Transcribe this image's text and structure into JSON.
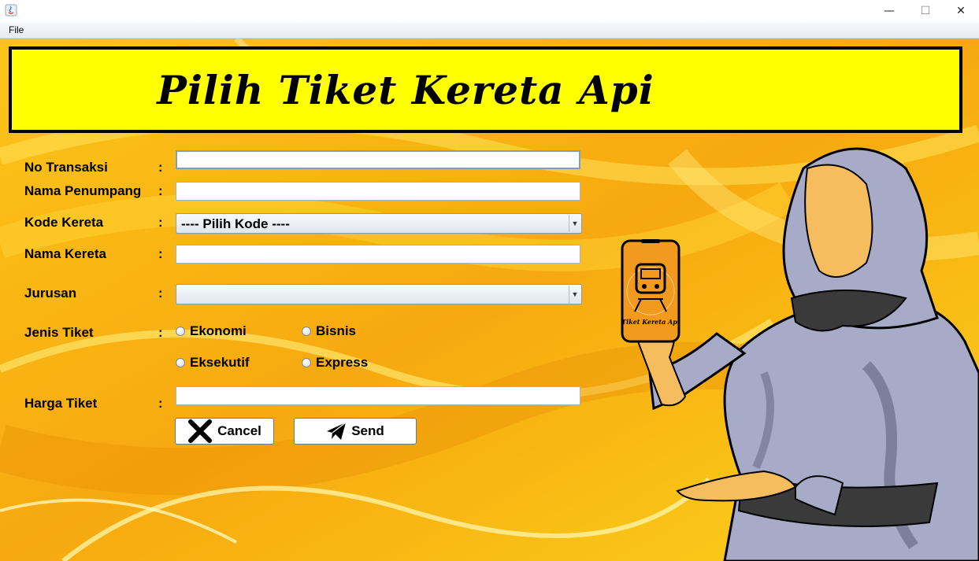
{
  "window": {
    "minimize_glyph": "—",
    "maximize_glyph": "☐",
    "close_glyph": "✕"
  },
  "menu": {
    "file_label": "File"
  },
  "banner": {
    "title": "Pilih Tiket Kereta Api"
  },
  "form": {
    "colon": ":",
    "no_transaksi": {
      "label": "No Transaksi",
      "value": ""
    },
    "nama_penumpang": {
      "label": "Nama Penumpang",
      "value": ""
    },
    "kode_kereta": {
      "label": "Kode Kereta",
      "selected": "---- Pilih Kode ----"
    },
    "nama_kereta": {
      "label": "Nama Kereta",
      "value": ""
    },
    "jurusan": {
      "label": "Jurusan",
      "selected": ""
    },
    "jenis_tiket": {
      "label": "Jenis Tiket",
      "options": [
        "Ekonomi",
        "Bisnis",
        "Eksekutif",
        "Express"
      ]
    },
    "harga_tiket": {
      "label": "Harga Tiket",
      "value": ""
    }
  },
  "buttons": {
    "cancel_label": "Cancel",
    "send_label": "Send"
  },
  "illustration": {
    "phone_caption": "Tiket Kereta Api"
  },
  "colors": {
    "background": "#f9b412",
    "banner": "#ffff00",
    "hijab": "#a8abc8",
    "skin": "#f6bd5e"
  }
}
